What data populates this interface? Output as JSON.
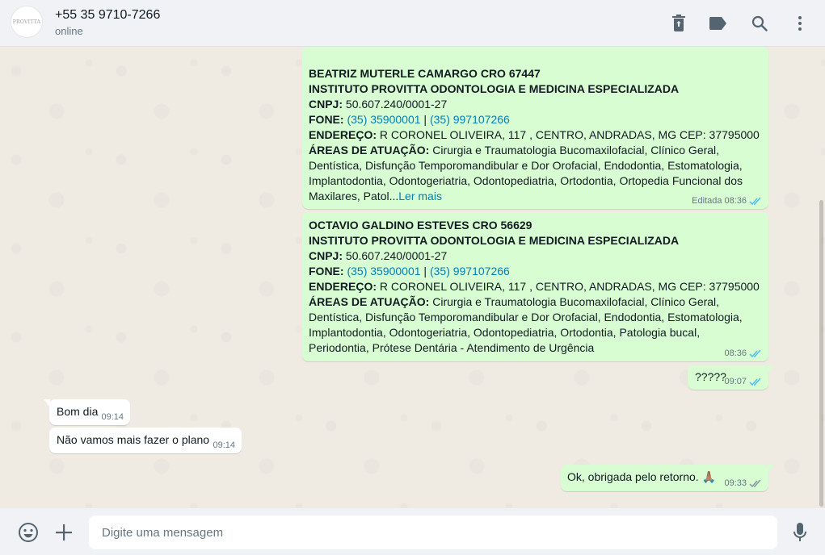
{
  "header": {
    "contact_name": "+55 35 9710-7266",
    "status": "online",
    "avatar_text": "PROVITTA",
    "icons": [
      "delete-icon",
      "label-icon",
      "search-icon",
      "menu-icon"
    ]
  },
  "messages": [
    {
      "type": "outgoing",
      "name_line": "BEATRIZ MUTERLE CAMARGO CRO 67447",
      "institute": "INSTITUTO PROVITTA ODONTOLOGIA E MEDICINA ESPECIALIZADA",
      "cnpj_label": "CNPJ:",
      "cnpj": " 50.607.240/0001-27",
      "fone_label": "FONE:",
      "phone1": "(35) 35900001",
      "separator": " | ",
      "phone2": "(35) 997107266",
      "address_label": "ENDEREÇO:",
      "address": " R CORONEL OLIVEIRA, 117 , CENTRO, ANDRADAS, MG CEP: 37795000",
      "areas_label": "ÁREAS DE ATUAÇÃO:",
      "areas": " Cirurgia e Traumatologia Bucomaxilofacial, Clínico Geral, Dentística, Disfunção Temporomandibular e Dor Orofacial, Endodontia, Estomatologia, Implantodontia, Odontogeriatria, Odontopediatria, Ortodontia, Ortopedia Funcional dos Maxilares, Patol...",
      "read_more": "Ler mais",
      "edited": "Editada",
      "time": "08:36"
    },
    {
      "type": "outgoing",
      "name_line": "OCTAVIO GALDINO ESTEVES CRO 56629",
      "institute": "INSTITUTO PROVITTA ODONTOLOGIA E MEDICINA ESPECIALIZADA",
      "cnpj_label": "CNPJ:",
      "cnpj": " 50.607.240/0001-27",
      "fone_label": "FONE:",
      "phone1": "(35) 35900001",
      "separator": " | ",
      "phone2": "(35) 997107266",
      "address_label": "ENDEREÇO:",
      "address": " R CORONEL OLIVEIRA, 117 , CENTRO, ANDRADAS, MG CEP: 37795000",
      "areas_label": "ÁREAS DE ATUAÇÃO:",
      "areas": " Cirurgia e Traumatologia Bucomaxilofacial, Clínico Geral, Dentística, Disfunção Temporomandibular e Dor Orofacial, Endodontia, Estomatologia, Implantodontia, Odontogeriatria, Odontopediatria, Ortodontia, Patologia bucal, Periodontia, Prótese Dentária - Atendimento de Urgência",
      "time": "08:36"
    },
    {
      "type": "outgoing",
      "text": "?????",
      "time": "09:07",
      "status": "read"
    },
    {
      "type": "incoming",
      "text": "Bom dia",
      "time": "09:14"
    },
    {
      "type": "incoming",
      "text": "Não vamos mais fazer o plano",
      "time": "09:14"
    },
    {
      "type": "outgoing",
      "text": "Ok, obrigada pelo retorno.",
      "emoji": "🙏🏽",
      "time": "09:33",
      "status": "delivered"
    }
  ],
  "composer": {
    "placeholder": "Digite uma mensagem",
    "icons": [
      "emoji-icon",
      "attach-plus-icon",
      "microphone-icon"
    ]
  },
  "colors": {
    "outgoing_bubble": "#d9fdd3",
    "incoming_bubble": "#ffffff",
    "chat_background": "#efeae2",
    "read_tick": "#53bdeb",
    "delivered_tick": "#8696a0",
    "link": "#027eb5"
  }
}
